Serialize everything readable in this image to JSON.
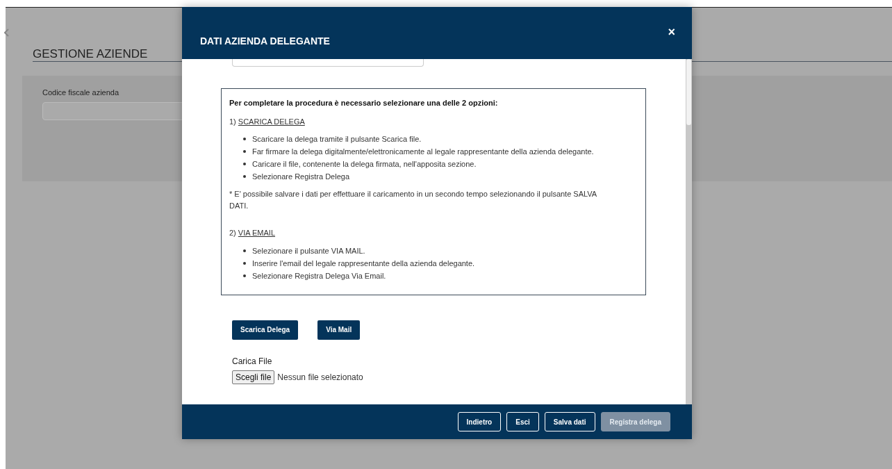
{
  "page": {
    "title": "GESTIONE AZIENDE",
    "filter_label": "Codice fiscale azienda"
  },
  "modal": {
    "title": "DATI AZIENDA DELEGANTE",
    "close": "×",
    "info": {
      "intro": "Per completare la procedura è necessario selezionare una delle 2 opzioni:",
      "sections": [
        {
          "number": "1)",
          "heading": "SCARICA DELEGA",
          "steps": [
            "Scaricare la delega tramite il pulsante Scarica file.",
            "Far firmare la delega digitalmente/elettronicamente al legale rappresentante della azienda delegante.",
            "Caricare il file, contenente la delega firmata, nell'apposita sezione.",
            "Selezionare Registra Delega"
          ],
          "note": "* E' possibile salvare i dati per effettuare il caricamento in un secondo tempo selezionando il pulsante SALVA DATI."
        },
        {
          "number": "2)",
          "heading": "VIA EMAIL",
          "steps": [
            "Selezionare il pulsante VIA MAIL.",
            "Inserire l'email del legale rappresentante della azienda delegante.",
            "Selezionare Registra Delega Via Email."
          ]
        }
      ]
    },
    "actions": [
      "Scarica Delega",
      "Via Mail"
    ],
    "upload": {
      "label": "Carica File",
      "button": "Scegli file",
      "status": "Nessun file selezionato"
    },
    "footer_buttons": [
      {
        "label": "Indietro",
        "disabled": false
      },
      {
        "label": "Esci",
        "disabled": false
      },
      {
        "label": "Salva dati",
        "disabled": false
      },
      {
        "label": "Registra delega",
        "disabled": true
      }
    ]
  }
}
